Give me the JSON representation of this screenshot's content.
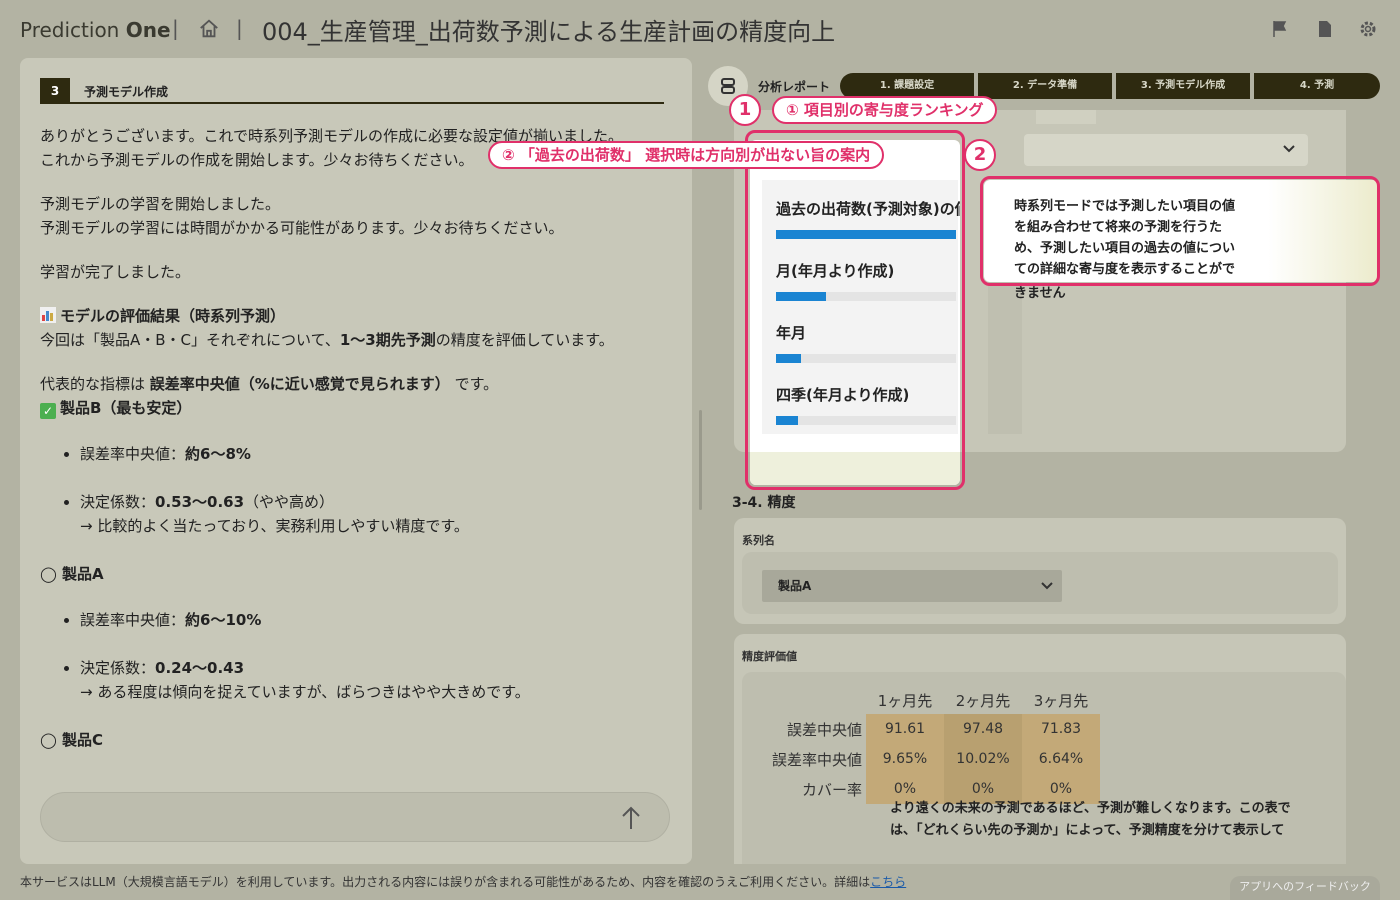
{
  "header": {
    "brand_light": "Prediction ",
    "brand_bold": "One",
    "separator": "|",
    "title": "004_生産管理_出荷数予測による生産計画の精度向上"
  },
  "left": {
    "step_number": "3",
    "step_label": "予測モデル作成",
    "messages": [
      "ありがとうございます。これで時系列予測モデルの作成に必要な設定値が揃いました。",
      "これから予測モデルの作成を開始します。少々お待ちください。",
      "予測モデルの学習を開始しました。",
      "予測モデルの学習には時間がかかる可能性があります。少々お待ちください。",
      "学習が完了しました。"
    ],
    "eval_heading": "モデルの評価結果（時系列予測）",
    "eval_intro_pre": "今回は「製品A・B・C」それぞれについて、",
    "eval_intro_bold": "1〜3期先予測",
    "eval_intro_post": "の精度を評価しています。",
    "metric_pre": "代表的な指標は ",
    "metric_bold": "誤差率中央値（%に近い感覚で見られます）",
    "metric_post": " です。",
    "product_b_title": "製品B（最も安定）",
    "b_err_label": "誤差率中央値：",
    "b_err_value": "約6〜8%",
    "b_r2_label": "決定係数：",
    "b_r2_value": "0.53〜0.63",
    "b_r2_note": "（やや高め）",
    "b_comment": "→ 比較的よく当たっており、実務利用しやすい精度です。",
    "product_a_title": "◯ 製品A",
    "a_err_label": "誤差率中央値：",
    "a_err_value": "約6〜10%",
    "a_r2_label": "決定係数：",
    "a_r2_value": "0.24〜0.43",
    "a_comment": "→ ある程度は傾向を捉えていますが、ばらつきはやや大きめです。",
    "product_c_title": "◯ 製品C"
  },
  "right": {
    "report_label": "分析レポート",
    "steps": [
      "1. 課題設定",
      "2. データ準備",
      "3. 予測モデル作成",
      "4. 予測"
    ],
    "section_title": "3-4. 精度",
    "series_label": "系列名",
    "series_value": "製品A",
    "accuracy_label": "精度評価値",
    "table": {
      "columns": [
        "1ヶ月先",
        "2ヶ月先",
        "3ヶ月先"
      ],
      "rows": [
        {
          "label": "誤差中央値",
          "values": [
            "91.61",
            "97.48",
            "71.83"
          ]
        },
        {
          "label": "誤差率中央値",
          "values": [
            "9.65%",
            "10.02%",
            "6.64%"
          ]
        },
        {
          "label": "カバー率",
          "values": [
            "0%",
            "0%",
            "0%"
          ]
        }
      ]
    },
    "note_line1": "より遠くの未来の予測であるほど、予測が難しくなります。この表で",
    "note_line2": "は、「どれくらい先の予測か」によって、予測精度を分けて表示して"
  },
  "popup": {
    "items": [
      {
        "label": "過去の出荷数(予測対象)の値",
        "value": 1.0
      },
      {
        "label": "月(年月より作成)",
        "value": 0.28
      },
      {
        "label": "年月",
        "value": 0.14
      },
      {
        "label": "四季(年月より作成)",
        "value": 0.12
      }
    ],
    "bar_color": "#1a84d2"
  },
  "tooltip": {
    "lines": [
      "時系列モードでは予測したい項目の値",
      "を組み合わせて将来の予測を行うた",
      "め、予測したい項目の過去の値につい",
      "ての詳細な寄与度を表示することがで"
    ],
    "overflow": "きません"
  },
  "annotations": {
    "num1": "1",
    "label1": "① 項目別の寄与度ランキング",
    "num2": "2",
    "label2": "② 「過去の出荷数」 選択時は方向別が出ない旨の案内",
    "color": "#e0306a"
  },
  "footer": {
    "text": "本サービスはLLM（大規模言語モデル）を利用しています。出力される内容には誤りが含まれる可能性があるため、内容を確認のうえご利用ください。詳細は",
    "link": "こちら",
    "feedback": "アプリへのフィードバック"
  }
}
